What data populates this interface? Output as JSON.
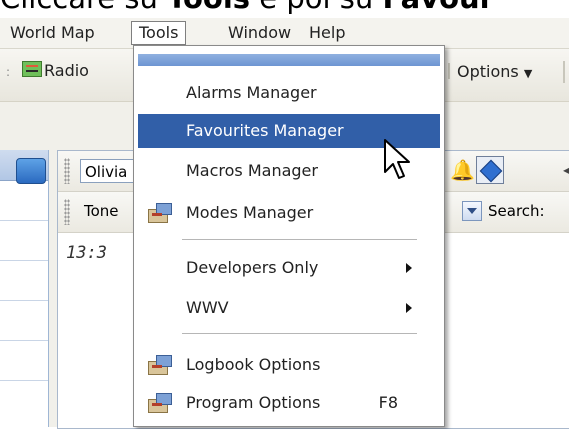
{
  "caption": {
    "part1": "Cliccare su ",
    "part2": "Tools",
    "part3": " e poi su ",
    "part4": "Favour"
  },
  "menubar": {
    "items": [
      "World Map",
      "Tools",
      "Window",
      "Help"
    ],
    "active": "Tools"
  },
  "toolbar": {
    "radio_label": "Radio",
    "options_label": "Options"
  },
  "main": {
    "mode_value": "Olivia",
    "tone_label": "Tone",
    "search_label": "Search:",
    "time_text": "13:3"
  },
  "tools_menu": {
    "items": [
      {
        "label": "Alarms Manager"
      },
      {
        "label": "Favourites Manager",
        "selected": true
      },
      {
        "label": "Macros Manager"
      },
      {
        "label": "Modes Manager",
        "icon": "settings-window-icon"
      },
      {
        "label": "Developers Only",
        "submenu": true
      },
      {
        "label": "WWV",
        "submenu": true
      },
      {
        "label": "Logbook Options",
        "icon": "settings-window-icon"
      },
      {
        "label": "Program Options",
        "shortcut": "F8",
        "icon": "settings-window-icon"
      }
    ]
  },
  "colors": {
    "selection": "#315fa8",
    "menu_header_bar": "#7fa3dc"
  }
}
